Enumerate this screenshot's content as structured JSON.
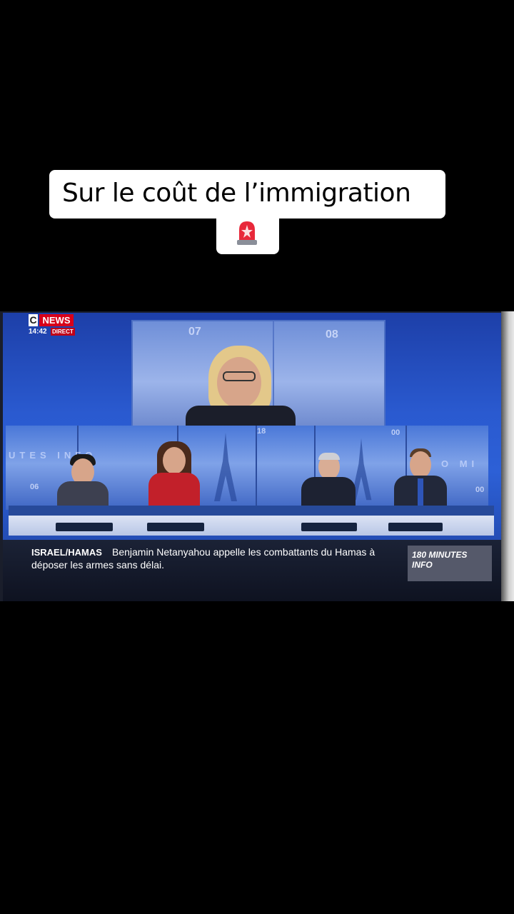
{
  "caption": {
    "text": "Sur le coût de l’immigration",
    "emoji_icon": "police-siren-icon"
  },
  "broadcast": {
    "channel_c": "C",
    "channel_news": "NEWS",
    "time": "14:42",
    "live_label": "DIRECT",
    "screen_numbers": [
      "07",
      "08",
      "18",
      "00",
      "06",
      "00"
    ],
    "wall_text_left": "UTES INFO",
    "wall_text_right": "O MI"
  },
  "ticker": {
    "topic": "ISRAEL/HAMAS",
    "line1": "Benjamin Netanyahou appelle les combattants du Hamas à",
    "line2": "déposer les armes sans délai.",
    "program_line1": "180 MINUTES",
    "program_line2": "INFO"
  },
  "colors": {
    "brand_red": "#d8001a",
    "studio_blue": "#2d60d6",
    "ticker_bg": "#0e1220"
  }
}
